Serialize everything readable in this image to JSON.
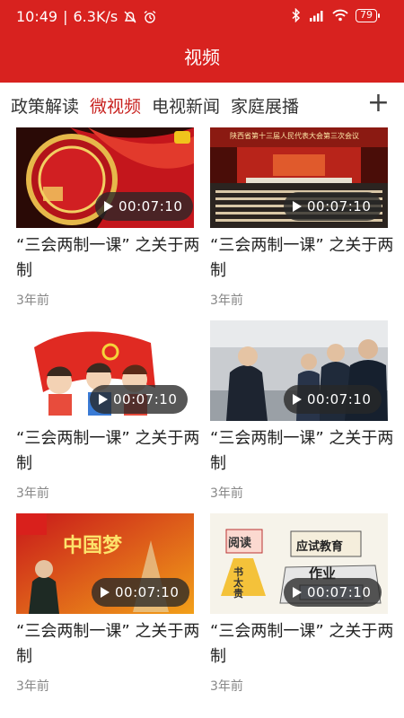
{
  "status_bar": {
    "time": "10:49",
    "network_speed": "6.3K/s",
    "battery": "79",
    "icons": [
      "mute-icon",
      "alarm-icon",
      "bluetooth-icon",
      "signal-icon",
      "wifi-icon",
      "battery-icon"
    ]
  },
  "header": {
    "title": "视频",
    "background": "#d8221f"
  },
  "tabs": {
    "items": [
      {
        "label": "政策解读",
        "active": false
      },
      {
        "label": "微视频",
        "active": true
      },
      {
        "label": "电视新闻",
        "active": false
      },
      {
        "label": "家庭展播",
        "active": false
      }
    ],
    "add_icon": "plus-icon",
    "active_color": "#c8211e"
  },
  "videos": [
    {
      "title": "“三会两制一课” 之关于两制",
      "duration": "00:07:10",
      "time_ago": "3年前",
      "thumb": "party-flag-emblem"
    },
    {
      "title": "“三会两制一课” 之关于两制",
      "duration": "00:07:10",
      "time_ago": "3年前",
      "thumb": "congress-hall",
      "thumb_caption": "陕西省第十三届人民代表大会第三次会议"
    },
    {
      "title": "“三会两制一课” 之关于两制",
      "duration": "00:07:10",
      "time_ago": "3年前",
      "thumb": "children-party-flag"
    },
    {
      "title": "“三会两制一课” 之关于两制",
      "duration": "00:07:10",
      "time_ago": "3年前",
      "thumb": "officials-meeting"
    },
    {
      "title": "“三会两制一课” 之关于两制",
      "duration": "00:07:10",
      "time_ago": "3年前",
      "thumb": "china-dream-poster",
      "thumb_caption": "中国梦"
    },
    {
      "title": "“三会两制一课” 之关于两制",
      "duration": "00:07:10",
      "time_ago": "3年前",
      "thumb": "education-cartoon",
      "thumb_caption": [
        "阅读",
        "书太贵",
        "应试教育",
        "作业"
      ]
    }
  ]
}
